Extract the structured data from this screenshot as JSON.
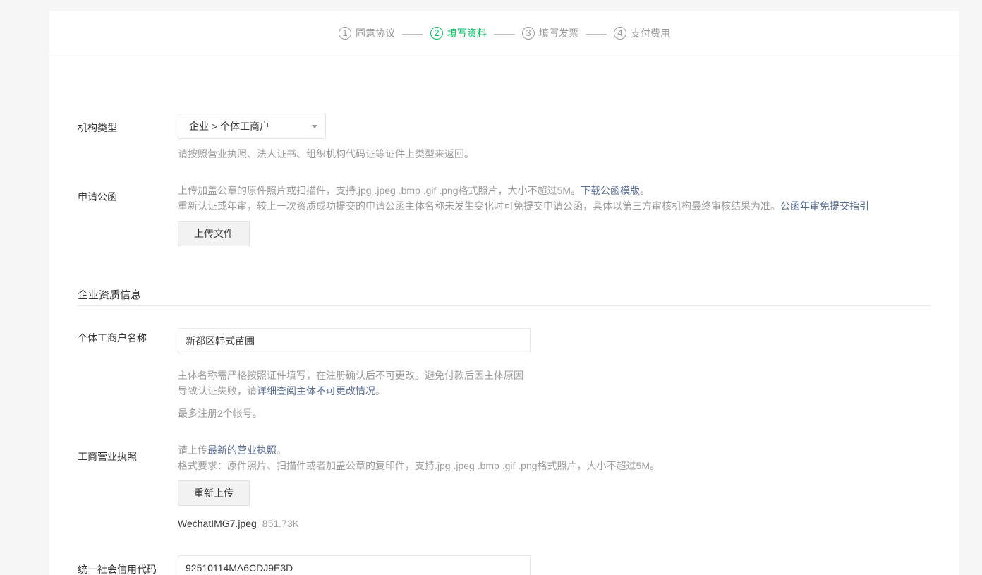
{
  "steps": [
    {
      "num": "1",
      "label": "同意协议"
    },
    {
      "num": "2",
      "label": "填写资料"
    },
    {
      "num": "3",
      "label": "填写发票"
    },
    {
      "num": "4",
      "label": "支付费用"
    }
  ],
  "org_type": {
    "label": "机构类型",
    "value": "企业 > 个体工商户",
    "tip": "请按照营业执照、法人证书、组织机构代码证等证件上类型来返回。"
  },
  "letter": {
    "label": "申请公函",
    "tip1": "上传加盖公章的原件照片或扫描件，支持.jpg .jpeg .bmp .gif .png格式照片，大小不超过5M。",
    "tip1_link": "下载公函模版",
    "tip1_end": "。",
    "tip2": "重新认证或年审，较上一次资质成功提交的申请公函主体名称未发生变化时可免提交申请公函，具体以第三方审核机构最终审核结果为准。",
    "tip2_link": "公函年审免提交指引",
    "upload_button": "上传文件"
  },
  "section": {
    "title": "企业资质信息"
  },
  "business_name": {
    "label": "个体工商户名称",
    "value": "新都区韩式苗圃",
    "tip1": "主体名称需严格按照证件填写，在注册确认后不可更改。避免付款后因主体原因",
    "tip2": "导致认证失败，请",
    "tip2_link": "详细查阅主体不可更改情况",
    "tip2_end": "。",
    "tip3": "最多注册2个帐号。"
  },
  "license": {
    "label": "工商营业执照",
    "tip1": "请上传",
    "tip1_link": "最新的营业执照",
    "tip1_end": "。",
    "tip2": "格式要求：原件照片、扫描件或者加盖公章的复印件，支持.jpg .jpeg .bmp .gif .png格式照片，大小不超过5M。",
    "reupload_button": "重新上传",
    "file_name": "WechatIMG7.jpeg",
    "file_size": "851.73K"
  },
  "credit_code": {
    "label": "统一社会信用代码",
    "value": "92510114MA6CDJ9E3D"
  },
  "colors": {
    "accent": "#07c160",
    "link": "#576b95",
    "muted": "#9a9a9a"
  }
}
